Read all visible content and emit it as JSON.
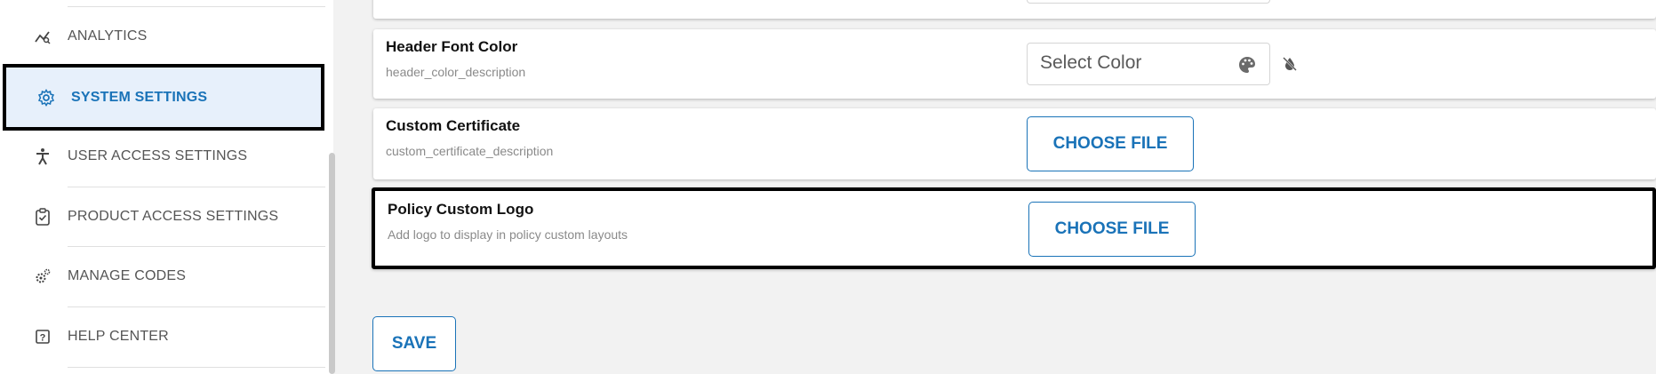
{
  "sidebar": {
    "items": [
      {
        "label": "ANALYTICS",
        "icon": "analytics-icon"
      },
      {
        "label": "SYSTEM SETTINGS",
        "icon": "gear-icon",
        "active": true
      },
      {
        "label": "USER ACCESS SETTINGS",
        "icon": "accessibility-icon"
      },
      {
        "label": "PRODUCT ACCESS SETTINGS",
        "icon": "clipboard-check-icon"
      },
      {
        "label": "MANAGE CODES",
        "icon": "gears-icon"
      },
      {
        "label": "HELP CENTER",
        "icon": "help-icon"
      }
    ]
  },
  "settings": {
    "header_font_color": {
      "title": "Header Font Color",
      "description": "header_color_description",
      "placeholder": "Select Color"
    },
    "custom_certificate": {
      "title": "Custom Certificate",
      "description": "custom_certificate_description",
      "button_label": "CHOOSE FILE"
    },
    "policy_custom_logo": {
      "title": "Policy Custom Logo",
      "description": "Add logo to display in policy custom layouts",
      "button_label": "CHOOSE FILE"
    }
  },
  "actions": {
    "save_label": "SAVE"
  },
  "colors": {
    "accent": "#1a73b8",
    "active_bg": "#e7f0fb",
    "highlight_border": "#000000"
  }
}
